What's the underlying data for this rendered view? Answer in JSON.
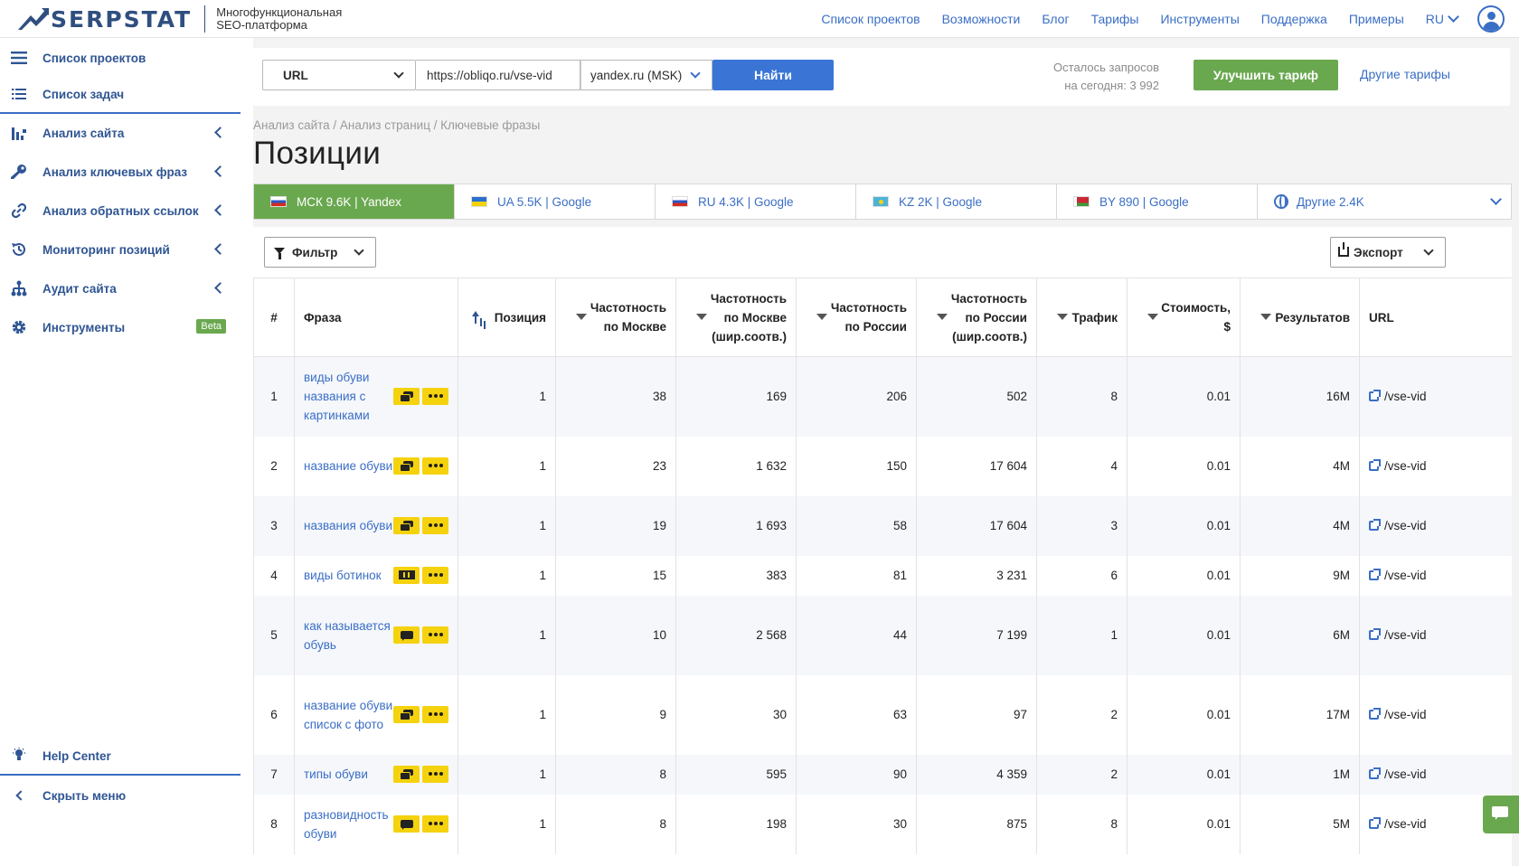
{
  "header": {
    "logo": "SERPSTAT",
    "tagline_1": "Многофункциональная",
    "tagline_2": "SEO-платформа",
    "nav": [
      "Список проектов",
      "Возможности",
      "Блог",
      "Тарифы",
      "Инструменты",
      "Поддержка",
      "Примеры"
    ],
    "lang": "RU"
  },
  "sidebar": {
    "items": [
      {
        "label": "Список проектов",
        "icon": "list-icon"
      },
      {
        "label": "Список задач",
        "icon": "tasks-icon"
      },
      {
        "label": "Анализ сайта",
        "icon": "chart-icon"
      },
      {
        "label": "Анализ ключевых фраз",
        "icon": "key-icon"
      },
      {
        "label": "Анализ обратных ссылок",
        "icon": "link-icon"
      },
      {
        "label": "Мониторинг позиций",
        "icon": "history-icon"
      },
      {
        "label": "Аудит сайта",
        "icon": "sitemap-icon"
      },
      {
        "label": "Инструменты",
        "icon": "gear-icon",
        "badge": "Beta"
      }
    ],
    "help": "Help Center",
    "hide": "Скрыть меню"
  },
  "search": {
    "type": "URL",
    "url_value": "https://obliqo.ru/vse-vid",
    "engine": "yandex.ru (MSK)",
    "find": "Найти",
    "quota_line1": "Осталось запросов",
    "quota_line2": "на сегодня: 3 992",
    "upgrade": "Улучшить тариф",
    "other_plans": "Другие тарифы"
  },
  "breadcrumb": "Анализ сайта / Анализ страниц / Ключевые фразы",
  "title": "Позиции",
  "tabs": [
    {
      "label": "МСК 9.6K | Yandex",
      "flag": "ru"
    },
    {
      "label": "UA 5.5K | Google",
      "flag": "ua"
    },
    {
      "label": "RU 4.3K | Google",
      "flag": "ru"
    },
    {
      "label": "KZ 2K | Google",
      "flag": "kz"
    },
    {
      "label": "BY 890 | Google",
      "flag": "by"
    },
    {
      "label": "Другие 2.4K",
      "flag": "globe"
    }
  ],
  "toolbar": {
    "filter": "Фильтр",
    "export": "Экспорт"
  },
  "table": {
    "headers": {
      "num": "#",
      "phrase": "Фраза",
      "position": "Позиция",
      "freq_msk_1": "Частотность",
      "freq_msk_2": "по Москве",
      "freq_msk_wide_1": "Частотность",
      "freq_msk_wide_2": "по Москве",
      "freq_msk_wide_3": "(шир.соотв.)",
      "freq_ru_1": "Частотность",
      "freq_ru_2": "по России",
      "freq_ru_wide_1": "Частотность",
      "freq_ru_wide_2": "по России",
      "freq_ru_wide_3": "(шир.соотв.)",
      "traffic": "Трафик",
      "cost_1": "Стоимость,",
      "cost_2": "$",
      "results": "Результатов",
      "url": "URL"
    },
    "rows": [
      {
        "n": "1",
        "phrase": "виды обуви названия с картинками",
        "icon": "chat2",
        "pos": "1",
        "fm": "38",
        "fmw": "169",
        "fr": "206",
        "frw": "502",
        "traffic": "8",
        "cost": "0.01",
        "results": "16M",
        "url": "/vse-vid"
      },
      {
        "n": "2",
        "phrase": "название обуви",
        "icon": "chat2",
        "pos": "1",
        "fm": "23",
        "fmw": "1 632",
        "fr": "150",
        "frw": "17 604",
        "traffic": "4",
        "cost": "0.01",
        "results": "4M",
        "url": "/vse-vid"
      },
      {
        "n": "3",
        "phrase": "названия обуви",
        "icon": "chat2",
        "pos": "1",
        "fm": "19",
        "fmw": "1 693",
        "fr": "58",
        "frw": "17 604",
        "traffic": "3",
        "cost": "0.01",
        "results": "4M",
        "url": "/vse-vid"
      },
      {
        "n": "4",
        "phrase": "виды ботинок",
        "icon": "film",
        "pos": "1",
        "fm": "15",
        "fmw": "383",
        "fr": "81",
        "frw": "3 231",
        "traffic": "6",
        "cost": "0.01",
        "results": "9M",
        "url": "/vse-vid"
      },
      {
        "n": "5",
        "phrase": "как называется обувь",
        "icon": "chat",
        "pos": "1",
        "fm": "10",
        "fmw": "2 568",
        "fr": "44",
        "frw": "7 199",
        "traffic": "1",
        "cost": "0.01",
        "results": "6M",
        "url": "/vse-vid"
      },
      {
        "n": "6",
        "phrase": "название обуви список с фото",
        "icon": "chat2",
        "pos": "1",
        "fm": "9",
        "fmw": "30",
        "fr": "63",
        "frw": "97",
        "traffic": "2",
        "cost": "0.01",
        "results": "17M",
        "url": "/vse-vid"
      },
      {
        "n": "7",
        "phrase": "типы обуви",
        "icon": "chat2",
        "pos": "1",
        "fm": "8",
        "fmw": "595",
        "fr": "90",
        "frw": "4 359",
        "traffic": "2",
        "cost": "0.01",
        "results": "1M",
        "url": "/vse-vid"
      },
      {
        "n": "8",
        "phrase": "разновидность обуви",
        "icon": "chat",
        "pos": "1",
        "fm": "8",
        "fmw": "198",
        "fr": "30",
        "frw": "875",
        "traffic": "8",
        "cost": "0.01",
        "results": "5M",
        "url": "/vse-vid"
      }
    ]
  }
}
